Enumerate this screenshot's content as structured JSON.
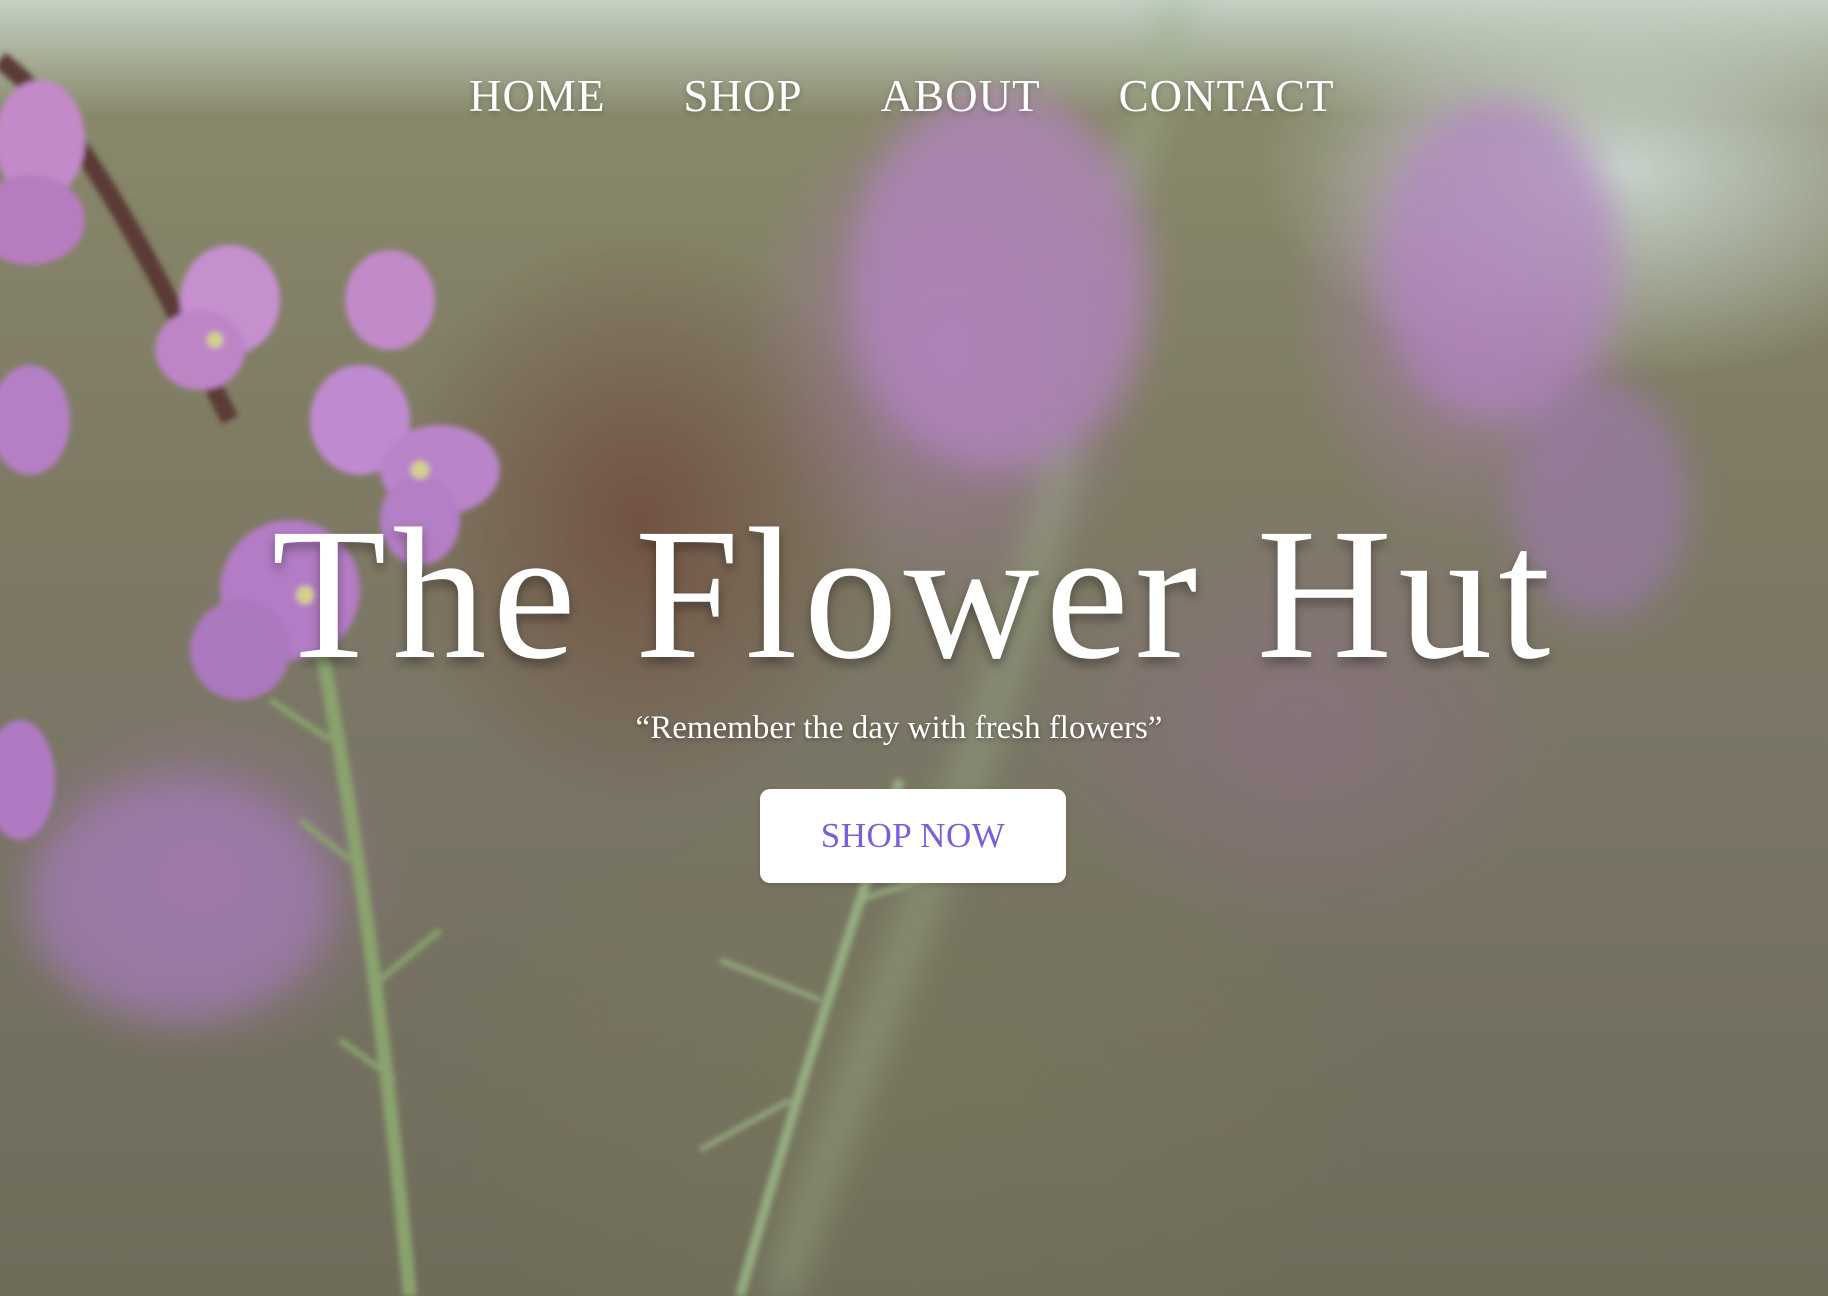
{
  "nav": {
    "items": [
      {
        "label": "HOME"
      },
      {
        "label": "SHOP"
      },
      {
        "label": "ABOUT"
      },
      {
        "label": "CONTACT"
      }
    ]
  },
  "hero": {
    "title": "The Flower Hut",
    "tagline": "“Remember the day with fresh flowers”",
    "cta_label": "SHOP NOW"
  },
  "colors": {
    "accent": "#7b5ed8",
    "text": "#ffffff",
    "button_bg": "#ffffff"
  },
  "background": {
    "icon": "blurred-purple-flowers-photo"
  }
}
